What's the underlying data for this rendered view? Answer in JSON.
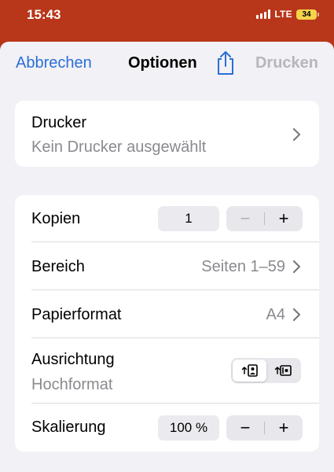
{
  "status_bar": {
    "time": "15:43",
    "network": "LTE",
    "battery": "34"
  },
  "nav": {
    "cancel_label": "Abbrechen",
    "title": "Optionen",
    "share_icon": "share-icon",
    "print_label": "Drucken"
  },
  "printer": {
    "title": "Drucker",
    "value": "Kein Drucker ausgewählt"
  },
  "options": {
    "copies": {
      "label": "Kopien",
      "value": "1",
      "minus": "−",
      "plus": "+"
    },
    "range": {
      "label": "Bereich",
      "value": "Seiten 1–59"
    },
    "paper_format": {
      "label": "Papierformat",
      "value": "A4"
    },
    "orientation": {
      "label": "Ausrichtung",
      "value": "Hochformat",
      "options": [
        "portrait-icon",
        "landscape-icon"
      ],
      "selected": "portrait-icon"
    },
    "scaling": {
      "label": "Skalierung",
      "value": "100 %",
      "minus": "−",
      "plus": "+"
    }
  },
  "colors": {
    "accent": "#2a6fd6",
    "status_bar_bg": "#b8361a",
    "disabled_text": "#b6b6bb",
    "secondary_text": "#8a8a8f",
    "battery_fill": "#f6d34a"
  }
}
